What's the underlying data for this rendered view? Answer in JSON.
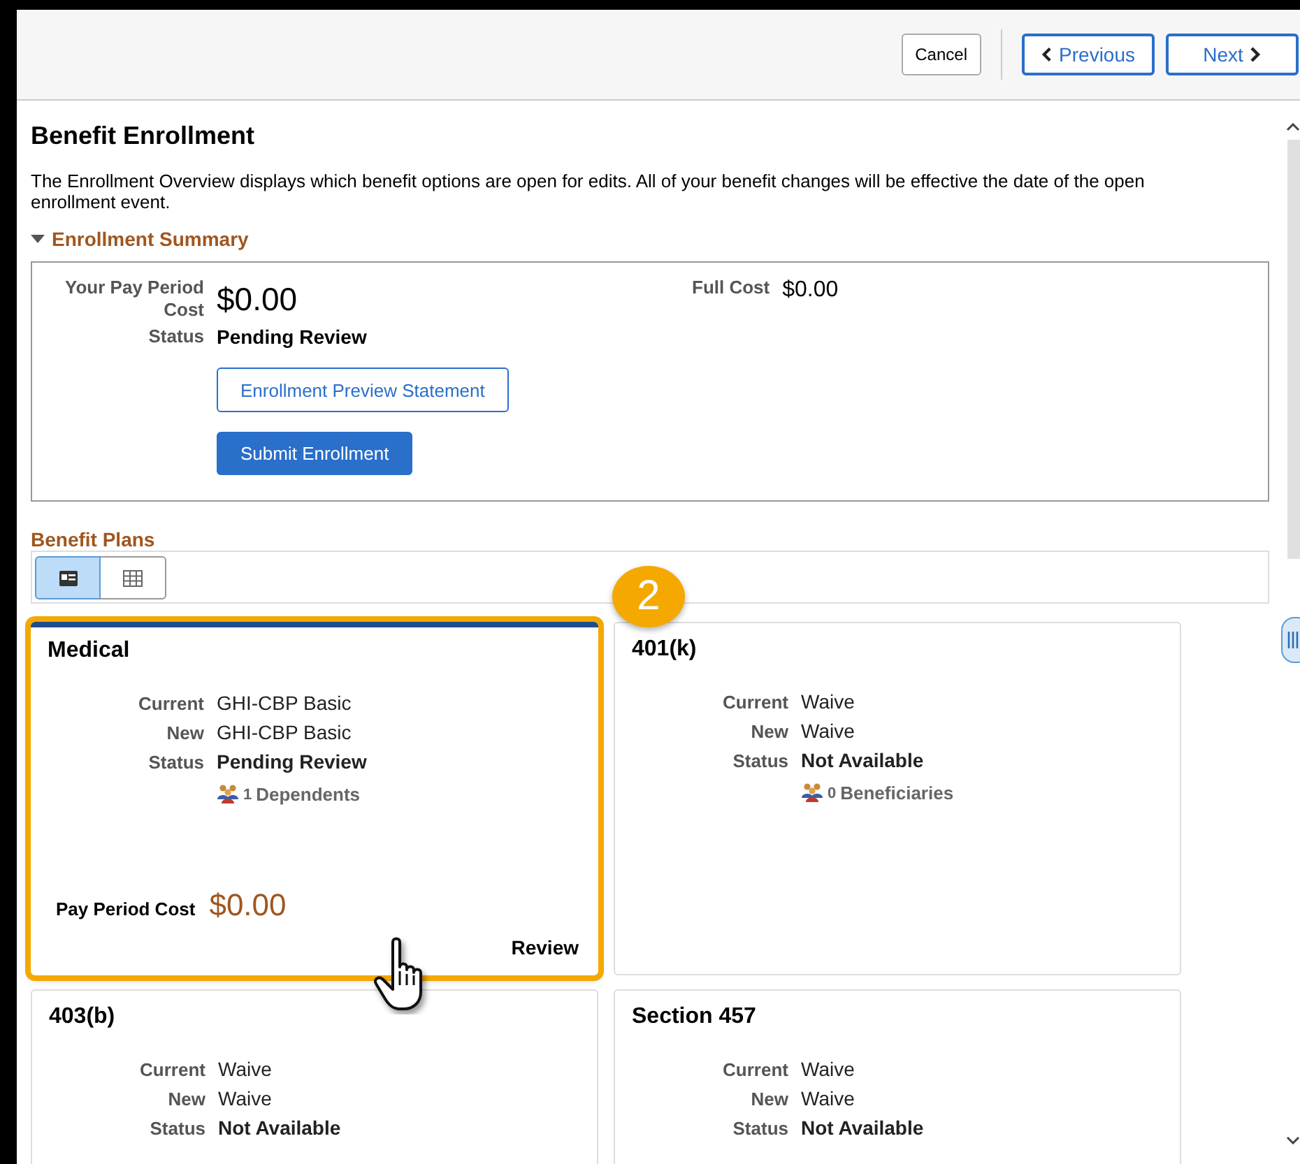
{
  "header": {
    "buttons": [
      {
        "label": "Cancel",
        "kind": "cancel"
      },
      {
        "label": "Previous",
        "kind": "previous"
      },
      {
        "label": "Next",
        "kind": "next"
      }
    ]
  },
  "page": {
    "title": "Benefit Enrollment",
    "description": "The Enrollment Overview displays which benefit options are open for edits. All of your benefit changes will be effective the date of the open enrollment event."
  },
  "summary": {
    "heading": "Enrollment Summary",
    "expanded": true,
    "pay_period_cost_label": "Your Pay Period Cost",
    "pay_period_cost": "$0.00",
    "full_cost_label": "Full Cost",
    "full_cost": "$0.00",
    "status_label": "Status",
    "status": "Pending Review",
    "preview_button": "Enrollment Preview Statement",
    "submit_button": "Submit Enrollment"
  },
  "benefit_plans": {
    "heading": "Benefit Plans",
    "views": [
      {
        "kind": "card",
        "selected": true
      },
      {
        "kind": "grid",
        "selected": false
      }
    ],
    "callout": {
      "label": "2"
    },
    "cards": [
      {
        "title": "Medical",
        "highlighted": true,
        "rows": [
          {
            "label": "Current",
            "value": "GHI-CBP Basic",
            "kind": "plain"
          },
          {
            "label": "New",
            "value": "GHI-CBP Basic",
            "kind": "plain"
          },
          {
            "label": "Status",
            "value": "Pending Review",
            "kind": "status"
          }
        ],
        "people": {
          "count": "1",
          "label": "Dependents"
        },
        "cost_label": "Pay Period Cost",
        "cost": "$0.00",
        "action": "Review"
      },
      {
        "title": "401(k)",
        "highlighted": false,
        "rows": [
          {
            "label": "Current",
            "value": "Waive",
            "kind": "plain"
          },
          {
            "label": "New",
            "value": "Waive",
            "kind": "plain"
          },
          {
            "label": "Status",
            "value": "Not Available",
            "kind": "status"
          }
        ],
        "people": {
          "count": "0",
          "label": "Beneficiaries"
        }
      },
      {
        "title": "403(b)",
        "highlighted": false,
        "rows": [
          {
            "label": "Current",
            "value": "Waive",
            "kind": "plain"
          },
          {
            "label": "New",
            "value": "Waive",
            "kind": "plain"
          },
          {
            "label": "Status",
            "value": "Not Available",
            "kind": "status"
          }
        ]
      },
      {
        "title": "Section 457",
        "highlighted": false,
        "rows": [
          {
            "label": "Current",
            "value": "Waive",
            "kind": "plain"
          },
          {
            "label": "New",
            "value": "Waive",
            "kind": "plain"
          },
          {
            "label": "Status",
            "value": "Not Available",
            "kind": "status"
          }
        ]
      }
    ]
  }
}
